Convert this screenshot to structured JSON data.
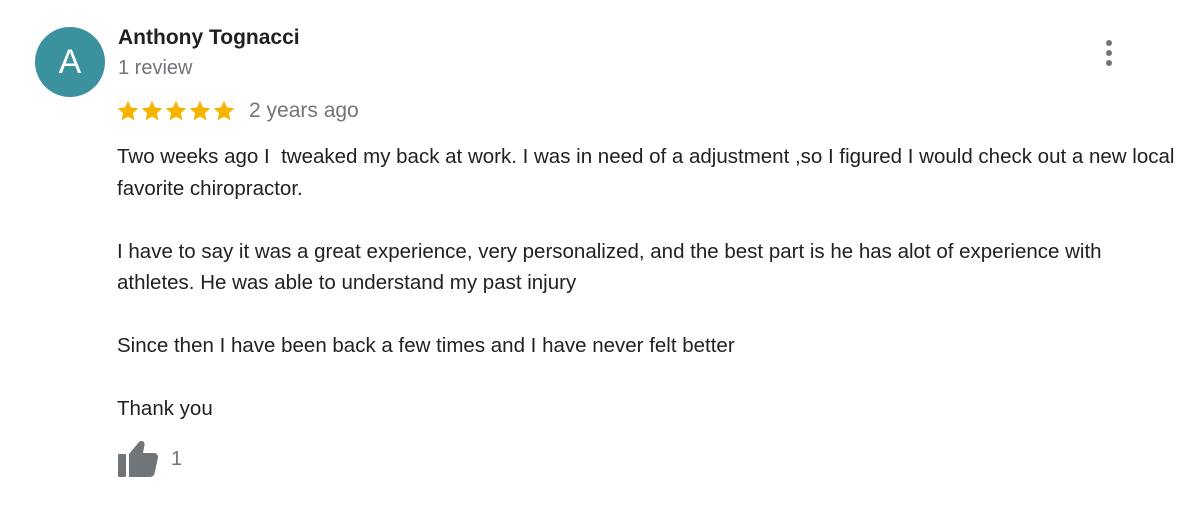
{
  "review": {
    "author": {
      "initial": "A",
      "name": "Anthony Tognacci",
      "review_count": "1 review",
      "avatar_color": "#3c919f"
    },
    "rating": {
      "stars": 5,
      "max_stars": 5,
      "star_color": "#f4b400"
    },
    "date": "2 years ago",
    "paragraphs": [
      "Two weeks ago I  tweaked my back at work. I was in need of a adjustment ,so I figured I would check out a new local favorite chiropractor.",
      "I have to say it was a great experience, very personalized, and the best part is he has alot of experience with athletes. He was able to understand my past injury",
      "Since then I have been back a few times and I have never felt better",
      "Thank you"
    ],
    "likes": "1",
    "icons": {
      "more": "more-vert-icon",
      "like": "thumb-up-icon",
      "star": "star-icon"
    }
  }
}
